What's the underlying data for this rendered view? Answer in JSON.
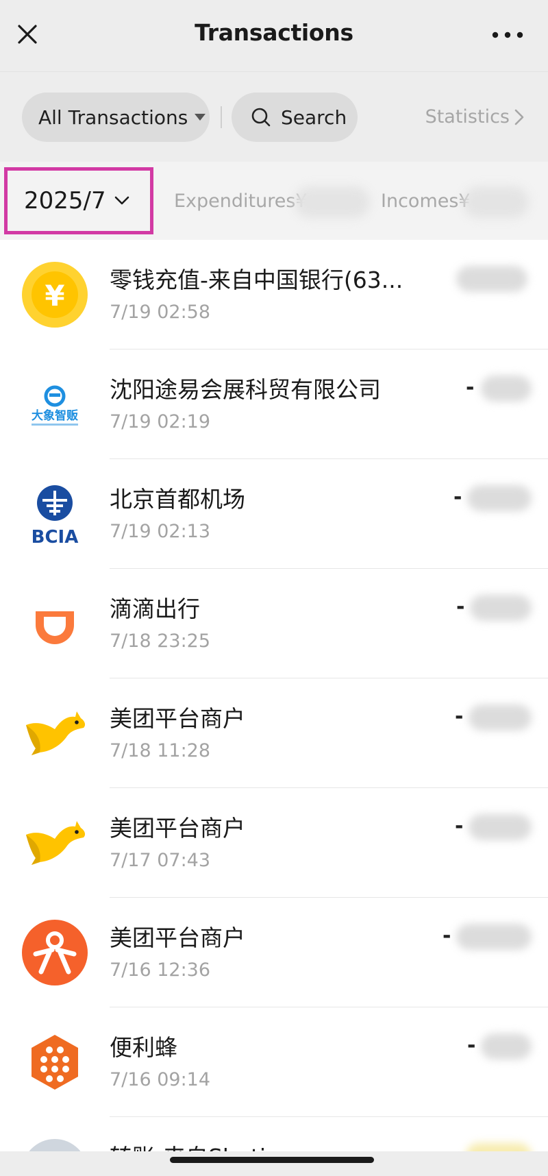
{
  "nav": {
    "title": "Transactions"
  },
  "filters": {
    "all_label": "All Transactions",
    "search_label": "Search",
    "statistics_label": "Statistics"
  },
  "summary": {
    "month": "2025/7",
    "expenditures_label": "Expenditures¥",
    "incomes_label": "Incomes¥"
  },
  "transactions": [
    {
      "name": "零钱充值-来自中国银行(63...",
      "time": "7/19 02:58",
      "icon": "yuan-coin-icon",
      "sign": ""
    },
    {
      "name": "沈阳途易会展科贸有限公司",
      "time": "7/19 02:19",
      "icon": "elephant-vending-icon",
      "sign": "-"
    },
    {
      "name": "北京首都机场",
      "time": "7/19 02:13",
      "icon": "bcia-icon",
      "sign": "-"
    },
    {
      "name": "滴滴出行",
      "time": "7/18 23:25",
      "icon": "didi-icon",
      "sign": "-"
    },
    {
      "name": "美团平台商户",
      "time": "7/18 11:28",
      "icon": "meituan-kangaroo-icon",
      "sign": "-"
    },
    {
      "name": "美团平台商户",
      "time": "7/17 07:43",
      "icon": "meituan-kangaroo-icon",
      "sign": "-"
    },
    {
      "name": "美团平台商户",
      "time": "7/16 12:36",
      "icon": "dianping-icon",
      "sign": "-"
    },
    {
      "name": "便利蜂",
      "time": "7/16 09:14",
      "icon": "bianlifeng-icon",
      "sign": "-"
    },
    {
      "name": "转账-来自Shatie",
      "time": "",
      "icon": "avatar-icon",
      "sign": ""
    }
  ],
  "colors": {
    "highlight": "#d23aa4",
    "coin": "#ffd230",
    "didi": "#fb7a3c",
    "meituan": "#ffc300",
    "dianping": "#f5612b",
    "bianlifeng": "#ef6b22",
    "bcia": "#1a4da1"
  }
}
